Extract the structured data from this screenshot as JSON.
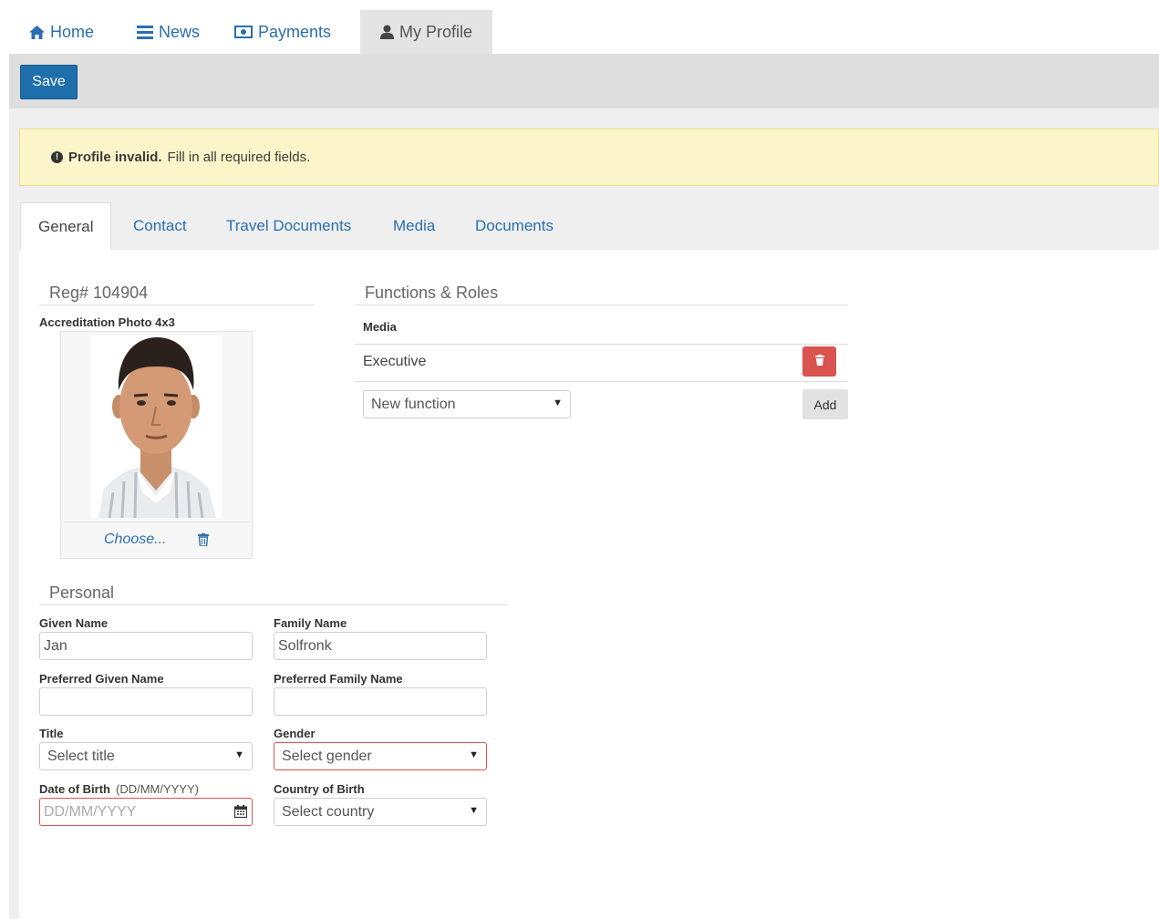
{
  "nav": {
    "items": [
      {
        "label": "Home",
        "icon": "home-icon"
      },
      {
        "label": "News",
        "icon": "news-icon"
      },
      {
        "label": "Payments",
        "icon": "money-icon"
      },
      {
        "label": "My Profile",
        "icon": "user-icon",
        "active": true
      }
    ]
  },
  "toolbar": {
    "save_label": "Save"
  },
  "alert": {
    "strong": "Profile invalid.",
    "text": "Fill in all required fields."
  },
  "tabs": [
    "General",
    "Contact",
    "Travel Documents",
    "Media",
    "Documents"
  ],
  "general": {
    "reg": "Reg# 104904",
    "photo_label": "Accreditation Photo 4x3",
    "choose_label": "Choose...",
    "functions": {
      "title": "Functions & Roles",
      "header": "Media",
      "items": [
        "Executive"
      ],
      "new_function_placeholder": "New function",
      "add_label": "Add"
    },
    "personal": {
      "title": "Personal",
      "given_name_label": "Given Name",
      "given_name_value": "Jan",
      "family_name_label": "Family Name",
      "family_name_value": "Solfronk",
      "pref_given_label": "Preferred Given Name",
      "pref_given_value": "",
      "pref_family_label": "Preferred Family Name",
      "pref_family_value": "",
      "title_label": "Title",
      "title_placeholder": "Select title",
      "gender_label": "Gender",
      "gender_placeholder": "Select gender",
      "dob_label": "Date of Birth",
      "dob_hint": "(DD/MM/YYYY)",
      "dob_placeholder": "DD/MM/YYYY",
      "country_label": "Country of Birth",
      "country_placeholder": "Select country"
    }
  },
  "colors": {
    "accent": "#1f6fad",
    "link": "#2a6fb0",
    "danger": "#d9534f",
    "alert_bg": "#fcf5c9"
  }
}
